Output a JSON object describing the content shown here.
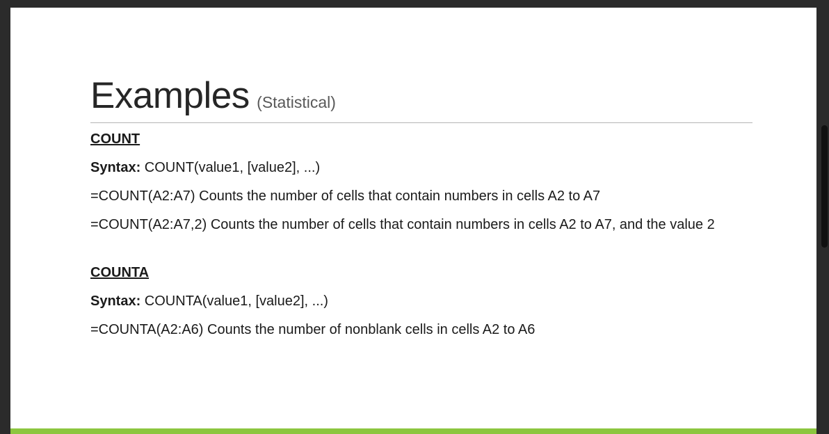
{
  "slide": {
    "title": "Examples",
    "subtitle": "(Statistical)",
    "sections": [
      {
        "heading": "COUNT",
        "syntax_label": "Syntax:",
        "syntax_text": " COUNT(value1, [value2], ...)",
        "examples": [
          "=COUNT(A2:A7) Counts the number of cells that contain numbers in cells A2 to A7",
          "=COUNT(A2:A7,2) Counts the number of cells that contain numbers in cells A2 to A7, and the value 2"
        ]
      },
      {
        "heading": "COUNTA",
        "syntax_label": "Syntax:",
        "syntax_text": " COUNTA(value1, [value2], ...)",
        "examples": [
          "=COUNTA(A2:A6) Counts the number of nonblank cells in cells A2 to A6"
        ]
      }
    ]
  },
  "colors": {
    "accent_bar": "#8cc63f",
    "background": "#2b2b2b",
    "slide": "#ffffff"
  }
}
